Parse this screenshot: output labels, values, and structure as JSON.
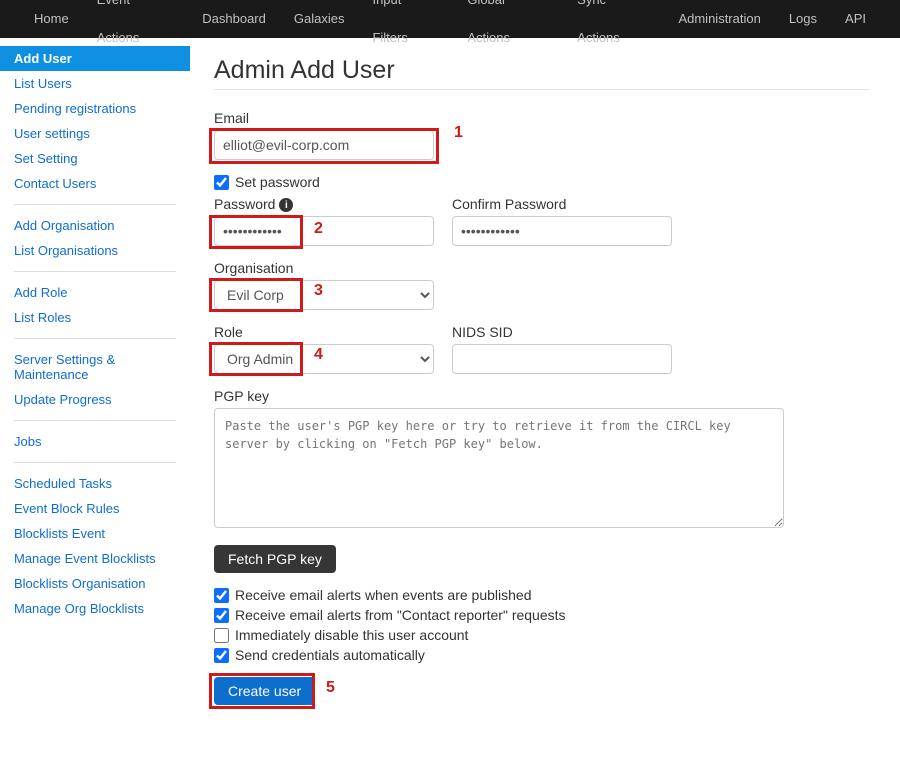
{
  "topnav": [
    "Home",
    "Event Actions",
    "Dashboard",
    "Galaxies",
    "Input Filters",
    "Global Actions",
    "Sync Actions",
    "Administration",
    "Logs",
    "API"
  ],
  "sidebar": {
    "groups": [
      [
        "Add User",
        "List Users",
        "Pending registrations",
        "User settings",
        "Set Setting",
        "Contact Users"
      ],
      [
        "Add Organisation",
        "List Organisations"
      ],
      [
        "Add Role",
        "List Roles"
      ],
      [
        "Server Settings & Maintenance",
        "Update Progress"
      ],
      [
        "Jobs"
      ],
      [
        "Scheduled Tasks",
        "Event Block Rules",
        "Blocklists Event",
        "Manage Event Blocklists",
        "Blocklists Organisation",
        "Manage Org Blocklists"
      ]
    ],
    "active": "Add User"
  },
  "page": {
    "title": "Admin Add User",
    "email_label": "Email",
    "email_value": "elliot@evil-corp.com",
    "set_password_label": "Set password",
    "set_password_checked": true,
    "password_label": "Password",
    "password_value": "••••••••••••",
    "confirm_password_label": "Confirm Password",
    "confirm_password_value": "••••••••••••",
    "organisation_label": "Organisation",
    "organisation_value": "Evil Corp",
    "role_label": "Role",
    "role_value": "Org Admin",
    "nids_sid_label": "NIDS SID",
    "nids_sid_value": "",
    "pgp_label": "PGP key",
    "pgp_placeholder": "Paste the user's PGP key here or try to retrieve it from the CIRCL key server by clicking on \"Fetch PGP key\" below.",
    "fetch_pgp_btn": "Fetch PGP key",
    "checkboxes": [
      {
        "label": "Receive email alerts when events are published",
        "checked": true
      },
      {
        "label": "Receive email alerts from \"Contact reporter\" requests",
        "checked": true
      },
      {
        "label": "Immediately disable this user account",
        "checked": false
      },
      {
        "label": "Send credentials automatically",
        "checked": true
      }
    ],
    "create_btn": "Create user"
  },
  "annotations": {
    "1": "1",
    "2": "2",
    "3": "3",
    "4": "4",
    "5": "5"
  }
}
